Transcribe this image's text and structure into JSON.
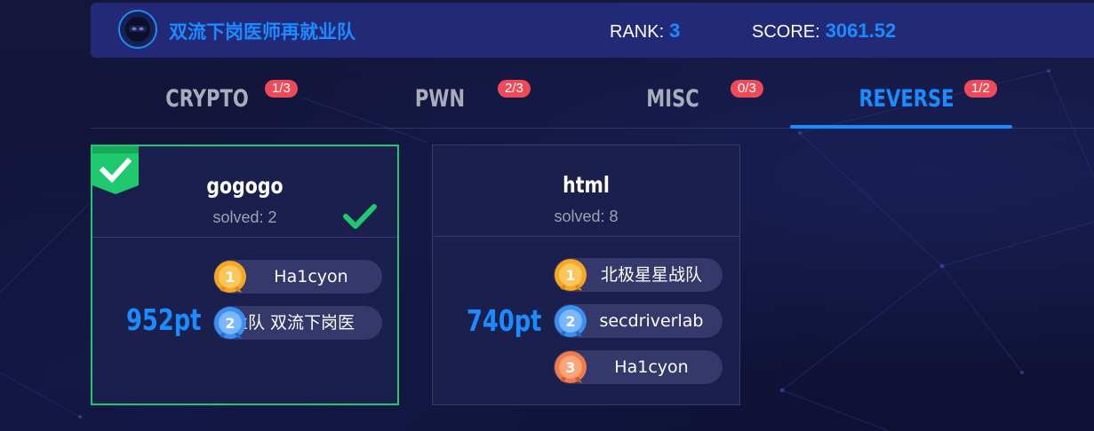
{
  "header": {
    "team_name": "双流下岗医师再就业队",
    "rank_label": "RANK:",
    "rank_value": "3",
    "score_label": "SCORE:",
    "score_value": "3061.52"
  },
  "tabs": [
    {
      "label": "CRYPTO",
      "badge": "1/3"
    },
    {
      "label": "PWN",
      "badge": "2/3"
    },
    {
      "label": "MISC",
      "badge": "0/3"
    },
    {
      "label": "REVERSE",
      "badge": "1/2"
    }
  ],
  "active_tab": "REVERSE",
  "cards": [
    {
      "title": "gogogo",
      "solved_text": "solved:  2",
      "points": "952pt",
      "is_solved_by_me": true,
      "solvers": [
        {
          "rank": "1",
          "name": "Ha1cyon"
        },
        {
          "rank": "2",
          "name": "业队    双流下岗医"
        }
      ]
    },
    {
      "title": "html",
      "solved_text": "solved:  8",
      "points": "740pt",
      "is_solved_by_me": false,
      "solvers": [
        {
          "rank": "1",
          "name": "北极星星战队"
        },
        {
          "rank": "2",
          "name": "secdriverlab"
        },
        {
          "rank": "3",
          "name": "Ha1cyon"
        }
      ]
    }
  ],
  "colors": {
    "accent": "#1a8cff",
    "badge": "#f04a58",
    "solved_green": "#1fc96e",
    "gold": "#f5a623",
    "silver_blue": "#3b8ff0",
    "bronze": "#f07a4a"
  },
  "icons": {
    "avatar": "ninja-avatar-icon",
    "solved_ribbon": "check-ribbon-icon",
    "solved_check": "checkmark-icon",
    "medal": "medal-icon"
  }
}
